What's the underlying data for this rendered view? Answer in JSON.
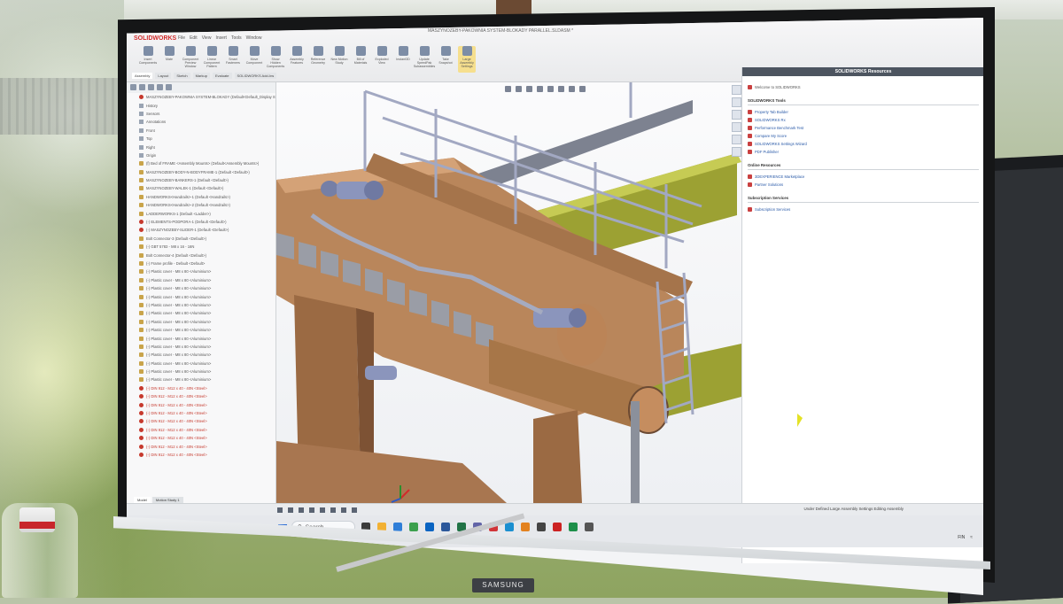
{
  "window": {
    "title": "MASZYNOZEBY-PAKOWNIA SYSTEM-BLOKADY PARALLEL.SLDASM *"
  },
  "app": {
    "logo": "SOLIDWORKS",
    "menu": [
      "File",
      "Edit",
      "View",
      "Insert",
      "Tools",
      "Window"
    ]
  },
  "ribbon": {
    "tools": [
      {
        "label": "Insert Components"
      },
      {
        "label": "Mate"
      },
      {
        "label": "Component Preview Window"
      },
      {
        "label": "Linear Component Pattern"
      },
      {
        "label": "Smart Fasteners"
      },
      {
        "label": "Move Component"
      },
      {
        "label": "Show Hidden Components"
      },
      {
        "label": "Assembly Features"
      },
      {
        "label": "Reference Geometry"
      },
      {
        "label": "New Motion Study"
      },
      {
        "label": "Bill of Materials"
      },
      {
        "label": "Exploded View"
      },
      {
        "label": "Instant3D"
      },
      {
        "label": "Update SpeedPak Subassemblies"
      },
      {
        "label": "Take Snapshot"
      },
      {
        "label": "Large Assembly Settings"
      }
    ],
    "tabs": [
      "Assembly",
      "Layout",
      "Sketch",
      "Markup",
      "Evaluate",
      "SOLIDWORKS Add-Ins"
    ]
  },
  "tree": {
    "tabs": [
      "Model",
      "Motion Study 1"
    ],
    "rows": [
      {
        "text": "MASZYNOZEBY-PAKOWNIA SYSTEM-BLOKADY (Default<Default_Display State-1>)",
        "kind": "error"
      },
      {
        "text": "History",
        "kind": "cube"
      },
      {
        "text": "Sensors",
        "kind": "cube"
      },
      {
        "text": "Annotations",
        "kind": "cube"
      },
      {
        "text": "Front",
        "kind": "cube"
      },
      {
        "text": "Top",
        "kind": "cube"
      },
      {
        "text": "Right",
        "kind": "cube"
      },
      {
        "text": "Origin",
        "kind": "cube"
      },
      {
        "text": "(f) Bed of FRAME <Assembly Mounts> (Default<Assembly Mounts>)",
        "kind": "tri"
      },
      {
        "text": "MASZYNOZEBY-BODY-N-BODYFRAME-1 (Default <Default>)",
        "kind": "tri"
      },
      {
        "text": "MASZYNOZEBY-BANKERS-1 (Default <Default>)",
        "kind": "tri"
      },
      {
        "text": "MASZYNOZEBY-WALEK-1 (Default <Default>)",
        "kind": "tri"
      },
      {
        "text": "HANDWORKS<Handrails>-1 (Default <Handrails>)",
        "kind": "tri"
      },
      {
        "text": "HANDWORKS<Handrails>-2 (Default <Handrails>)",
        "kind": "tri"
      },
      {
        "text": "LADDERWORKS-1 (Default <Ladder>)",
        "kind": "tri"
      },
      {
        "text": "(-) ELEMENTS-PODPORA-1 (Default <Default>)",
        "kind": "error"
      },
      {
        "text": "(-) MASZYNOZEBY-SLIDER-1 (Default <Default>)",
        "kind": "error"
      },
      {
        "text": "Bolt Connector-3 (Default <Default>)",
        "kind": "tri"
      },
      {
        "text": "(-) GBT 5783 - M8 x 16 - 16N",
        "kind": "tri"
      },
      {
        "text": "Bolt Connector-4 (Default <Default>)",
        "kind": "tri"
      },
      {
        "text": "(-) Frame profile - Default <Default>",
        "kind": "tri"
      },
      {
        "text": "(-) Plastic cover - M8 x 80 <Aluminium>",
        "kind": "tri"
      },
      {
        "text": "(-) Plastic cover - M8 x 80 <Aluminium>",
        "kind": "tri"
      },
      {
        "text": "(-) Plastic cover - M8 x 80 <Aluminium>",
        "kind": "tri"
      },
      {
        "text": "(-) Plastic cover - M8 x 80 <Aluminium>",
        "kind": "tri"
      },
      {
        "text": "(-) Plastic cover - M8 x 80 <Aluminium>",
        "kind": "tri"
      },
      {
        "text": "(-) Plastic cover - M8 x 80 <Aluminium>",
        "kind": "tri"
      },
      {
        "text": "(-) Plastic cover - M8 x 80 <Aluminium>",
        "kind": "tri"
      },
      {
        "text": "(-) Plastic cover - M8 x 80 <Aluminium>",
        "kind": "tri"
      },
      {
        "text": "(-) Plastic cover - M8 x 80 <Aluminium>",
        "kind": "tri"
      },
      {
        "text": "(-) Plastic cover - M8 x 80 <Aluminium>",
        "kind": "tri"
      },
      {
        "text": "(-) Plastic cover - M8 x 80 <Aluminium>",
        "kind": "tri"
      },
      {
        "text": "(-) Plastic cover - M8 x 80 <Aluminium>",
        "kind": "tri"
      },
      {
        "text": "(-) Plastic cover - M8 x 80 <Aluminium>",
        "kind": "tri"
      },
      {
        "text": "(-) Plastic cover - M8 x 80 <Aluminium>",
        "kind": "tri"
      },
      {
        "text": "(-) DIN 912 - M12 x 40 - 40N <Steel>",
        "kind": "warn"
      },
      {
        "text": "(-) DIN 912 - M12 x 40 - 40N <Steel>",
        "kind": "warn"
      },
      {
        "text": "(-) DIN 912 - M12 x 40 - 40N <Steel>",
        "kind": "warn"
      },
      {
        "text": "(-) DIN 912 - M12 x 40 - 40N <Steel>",
        "kind": "warn"
      },
      {
        "text": "(-) DIN 912 - M12 x 40 - 40N <Steel>",
        "kind": "warn"
      },
      {
        "text": "(-) DIN 912 - M12 x 40 - 40N <Steel>",
        "kind": "warn"
      },
      {
        "text": "(-) DIN 912 - M12 x 40 - 40N <Steel>",
        "kind": "warn"
      },
      {
        "text": "(-) DIN 912 - M12 x 40 - 40N <Steel>",
        "kind": "warn"
      },
      {
        "text": "(-) DIN 912 - M12 x 40 - 40N <Steel>",
        "kind": "warn"
      }
    ]
  },
  "task_pane": {
    "title": "SOLIDWORKS Resources",
    "welcome": "Welcome to SOLIDWORKS",
    "tools_title": "SOLIDWORKS Tools",
    "tools": [
      "Property Tab Builder",
      "SOLIDWORKS Rx",
      "Performance Benchmark Test",
      "Compare My Score",
      "SOLIDWORKS Settings Wizard",
      "PDF Publisher"
    ],
    "online_title": "Online Resources",
    "online": [
      "3DEXPERIENCE Marketplace",
      "Partner Solutions"
    ],
    "subscription_title": "Subscription Services",
    "subscription": [
      "Subscription Services"
    ]
  },
  "statusbar": {
    "text": "Under Defined   Large Assembly Settings   Editing Assembly"
  },
  "taskbar": {
    "search_placeholder": "Search",
    "language": "FIN"
  },
  "monitor": {
    "brand": "SAMSUNG"
  },
  "colors": {
    "model_brown": "#bf8a5f",
    "rail_grey": "#b9bdd0",
    "beam_yellow": "#a9ad38",
    "accent_red": "#d12b2b"
  }
}
